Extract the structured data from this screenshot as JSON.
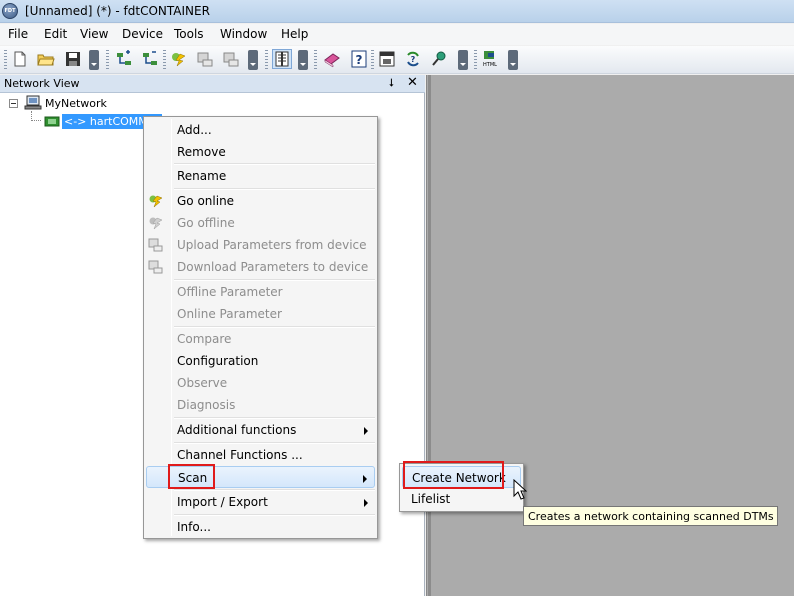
{
  "window": {
    "title": "[Unnamed] (*)  - fdtCONTAINER",
    "icon_text": "FDT"
  },
  "menubar": [
    "File",
    "Edit",
    "View",
    "Device",
    "Tools",
    "Window",
    "Help"
  ],
  "toolbar": {
    "icons": [
      "new-file-icon",
      "open-folder-icon",
      "save-icon",
      "add-device-icon",
      "remove-device-icon",
      "go-online-icon",
      "upload-icon",
      "download-icon",
      "network-view-icon",
      "book-icon",
      "help-icon",
      "device-catalog-icon",
      "update-catalog-icon",
      "connect-icon",
      "html-export-icon"
    ],
    "html_label": "HTML"
  },
  "panel": {
    "title": "Network View",
    "pin": "⭣",
    "close": "✕"
  },
  "tree": {
    "root": "MyNetwork",
    "child": "<-> hartCOMMDTM"
  },
  "context_menu": {
    "items": [
      {
        "label": "Add...",
        "enabled": true
      },
      {
        "label": "Remove",
        "enabled": true
      },
      {
        "label": "Rename",
        "enabled": true
      },
      {
        "label": "Go online",
        "enabled": true
      },
      {
        "label": "Go offline",
        "enabled": false
      },
      {
        "label": "Upload Parameters from device",
        "enabled": false
      },
      {
        "label": "Download Parameters to device",
        "enabled": false
      },
      {
        "label": "Offline Parameter",
        "enabled": false
      },
      {
        "label": "Online Parameter",
        "enabled": false
      },
      {
        "label": "Compare",
        "enabled": false
      },
      {
        "label": "Configuration",
        "enabled": true
      },
      {
        "label": "Observe",
        "enabled": false
      },
      {
        "label": "Diagnosis",
        "enabled": false
      },
      {
        "label": "Additional functions",
        "enabled": true
      },
      {
        "label": "Channel Functions ...",
        "enabled": true
      },
      {
        "label": "Scan",
        "enabled": true
      },
      {
        "label": "Import / Export",
        "enabled": true
      },
      {
        "label": "Info...",
        "enabled": true
      }
    ]
  },
  "submenu": {
    "items": [
      "Create Network",
      "Lifelist"
    ]
  },
  "tooltip": "Creates a network containing scanned DTMs",
  "colors": {
    "selection": "#3399ff",
    "highlight_border": "#e01b1b",
    "workspace": "#ababab"
  }
}
